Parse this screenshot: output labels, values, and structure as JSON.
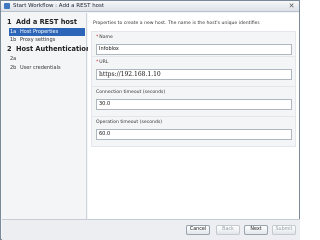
{
  "window": {
    "title": "Start Workflow : Add a REST host",
    "close_glyph": "✕"
  },
  "steps": [
    {
      "number": "1",
      "label": "Add a REST host",
      "substeps": [
        {
          "number": "1a",
          "label": "Host Properties",
          "active": true
        },
        {
          "number": "1b",
          "label": "Proxy settings",
          "active": false
        }
      ]
    },
    {
      "number": "2",
      "label": "Host Authentication",
      "substeps": [
        {
          "number": "2a",
          "label": "",
          "active": false
        },
        {
          "number": "2b",
          "label": "User credentials",
          "active": false
        }
      ]
    }
  ],
  "form": {
    "description": "Properties to create a new host. The name is the host's unique identifier.",
    "fields": [
      {
        "label": "Name",
        "required": true,
        "value": "Infoblox"
      },
      {
        "label": "URL",
        "required": true,
        "value": "https://192.168.1.10"
      },
      {
        "label": "Connection timeout (seconds)",
        "required": false,
        "value": "30.0"
      },
      {
        "label": "Operation timeout (seconds)",
        "required": false,
        "value": "60.0"
      }
    ]
  },
  "footer": {
    "buttons": [
      {
        "label": "Cancel",
        "enabled": true
      },
      {
        "label": "Back",
        "enabled": false
      },
      {
        "label": "Next",
        "enabled": true
      },
      {
        "label": "Submit",
        "enabled": false
      }
    ]
  },
  "colors": {
    "active_step_bg": "#2d66b8",
    "required_marker": "#d21f1f"
  }
}
